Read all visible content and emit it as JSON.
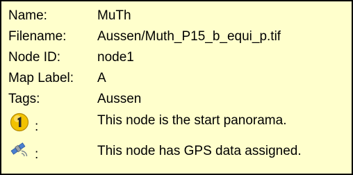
{
  "info": {
    "rows": [
      {
        "label": "Name:",
        "value": "MuTh"
      },
      {
        "label": "Filename:",
        "value": "Aussen/Muth_P15_b_equi_p.tif"
      },
      {
        "label": "Node ID:",
        "value": "node1"
      },
      {
        "label": "Map Label:",
        "value": "A"
      },
      {
        "label": "Tags:",
        "value": "Aussen"
      }
    ],
    "start": {
      "icon": "start-panorama-icon",
      "colon": ":",
      "text": "This node is the start panorama."
    },
    "gps": {
      "icon": "gps-satellite-icon",
      "colon": ":",
      "text": "This node has GPS data assigned."
    }
  },
  "colors": {
    "background": "#ffffcc",
    "border": "#000000",
    "start_badge": "#f2c200"
  }
}
